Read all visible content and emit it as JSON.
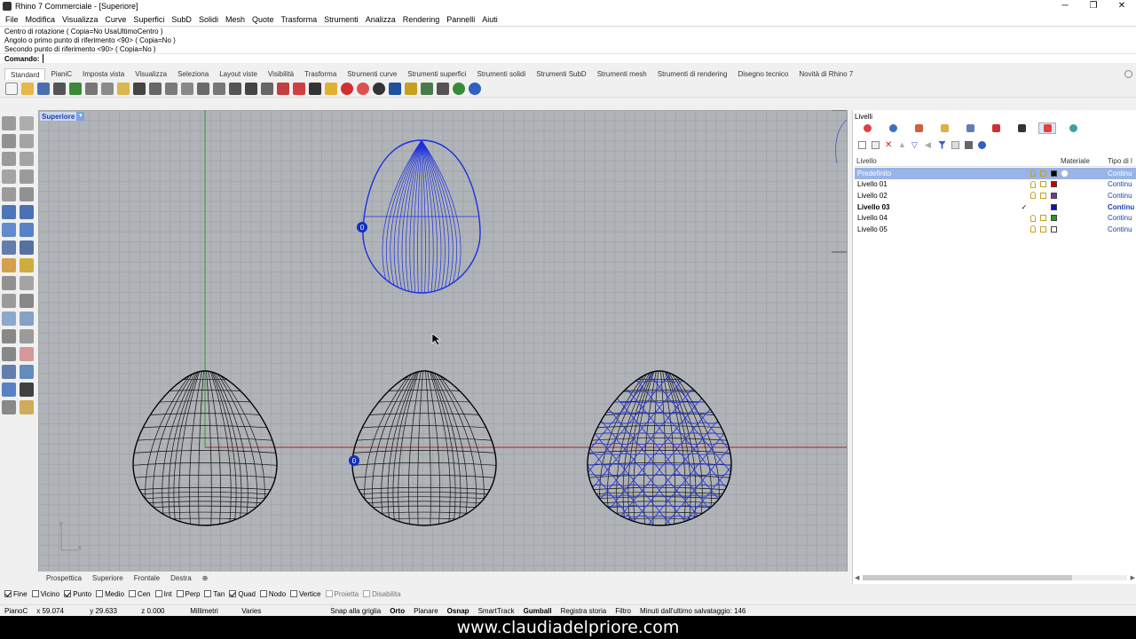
{
  "window": {
    "title": "Rhino 7 Commerciale - [Superiore]",
    "minimize": "─",
    "maximize": "❐",
    "close": "✕"
  },
  "menu": [
    "File",
    "Modifica",
    "Visualizza",
    "Curve",
    "Superfici",
    "SubD",
    "Solidi",
    "Mesh",
    "Quote",
    "Trasforma",
    "Strumenti",
    "Analizza",
    "Rendering",
    "Pannelli",
    "Aiuti"
  ],
  "command_history": [
    "Centro di rotazione ( Copia=No  UsaUltimoCentro )",
    "Angolo o primo punto di riferimento <90> ( Copia=No )",
    "Secondo punto di riferimento <90> ( Copia=No )"
  ],
  "command_prompt": {
    "label": "Comando:",
    "value": ""
  },
  "toolbar_tabs": [
    "Standard",
    "PianiC",
    "Imposta vista",
    "Visualizza",
    "Seleziona",
    "Layout viste",
    "Visibilità",
    "Trasforma",
    "Strumenti curve",
    "Strumenti superfici",
    "Strumenti solidi",
    "Strumenti SubD",
    "Strumenti mesh",
    "Strumenti di rendering",
    "Disegno tecnico",
    "Novità di Rhino 7"
  ],
  "toolbar_icons": [
    "new-icon",
    "open-icon",
    "save-icon",
    "print-icon",
    "import-icon",
    "cut-icon",
    "copy-icon",
    "paste-icon",
    "undo-icon",
    "pan-icon",
    "rotate-view-icon",
    "zoom-in-icon",
    "zoom-window-icon",
    "zoom-extents-icon",
    "zoom-selected-icon",
    "undo-view-icon",
    "grid-icon",
    "layer-icon",
    "hide-icon",
    "lock-icon",
    "light-icon",
    "material-icon",
    "color-icon",
    "render-icon",
    "display-mode-icon",
    "properties-icon",
    "osnap-icon",
    "options-icon",
    "globe-icon",
    "help-icon"
  ],
  "colors": {
    "toolbar_icons": [
      "#f5f5f5",
      "#e6b84a",
      "#4a6fb0",
      "#555555",
      "#3a8a3a",
      "#777777",
      "#8a8a8a",
      "#d9b650",
      "#444444",
      "#666666",
      "#7a7a7a",
      "#888888",
      "#6a6a6a",
      "#777777",
      "#555555",
      "#444444",
      "#666666",
      "#c04040",
      "#d04040",
      "#333333",
      "#e0b030",
      "#d03030",
      "#e05050",
      "#333333",
      "#2050a0",
      "#c8a020",
      "#4a7a4a",
      "#555555",
      "#3a8a3a",
      "#3060c0"
    ]
  },
  "viewport": {
    "title": "Superiore",
    "marker_top": "0",
    "marker_bottom": "0",
    "axis_x": "x",
    "axis_y": "y"
  },
  "viewport_tabs": [
    "Prospettica",
    "Superiore",
    "Frontale",
    "Destra",
    "⊕"
  ],
  "osnaps": [
    {
      "label": "Fine",
      "checked": true
    },
    {
      "label": "Vicino",
      "checked": false
    },
    {
      "label": "Punto",
      "checked": true
    },
    {
      "label": "Medio",
      "checked": false
    },
    {
      "label": "Cen",
      "checked": false
    },
    {
      "label": "Int",
      "checked": false
    },
    {
      "label": "Perp",
      "checked": false
    },
    {
      "label": "Tan",
      "checked": false
    },
    {
      "label": "Quad",
      "checked": true
    },
    {
      "label": "Nodo",
      "checked": false
    },
    {
      "label": "Vertice",
      "checked": false
    },
    {
      "label": "Proietta",
      "checked": false
    },
    {
      "label": "Disabilita",
      "checked": false
    }
  ],
  "statusbar": {
    "cplane": "PianoC",
    "x": "x 59.074",
    "y": "y 29.633",
    "z": "z 0.000",
    "units": "Millimetri",
    "layer": "Varies",
    "snap": "Snap alla griglia",
    "ortho": "Orto",
    "planar": "Planare",
    "osnap": "Osnap",
    "smarttrack": "SmartTrack",
    "gumball": "Gumball",
    "history": "Registra storia",
    "filter": "Filtro",
    "autosave": "Minuti dall'ultimo salvataggio: 146"
  },
  "panel": {
    "title": "Livelli",
    "columns": {
      "name": "Livello",
      "material": "Materiale",
      "linetype": "Tipo di l"
    },
    "layers": [
      {
        "name": "Predefinito",
        "color": "#000000",
        "selected": true,
        "current": false,
        "linetype": "Continu"
      },
      {
        "name": "Livello 01",
        "color": "#c00000",
        "selected": false,
        "current": false,
        "linetype": "Continu"
      },
      {
        "name": "Livello 02",
        "color": "#8030a0",
        "selected": false,
        "current": false,
        "linetype": "Continu"
      },
      {
        "name": "Livello 03",
        "color": "#1010c0",
        "selected": false,
        "current": true,
        "linetype": "Continu"
      },
      {
        "name": "Livello 04",
        "color": "#20a020",
        "selected": false,
        "current": false,
        "linetype": "Continu"
      },
      {
        "name": "Livello 05",
        "color": "#ffffff",
        "selected": false,
        "current": false,
        "linetype": "Continu"
      }
    ],
    "current_mark": "✓"
  },
  "watermark": "www.claudiadelpriore.com"
}
